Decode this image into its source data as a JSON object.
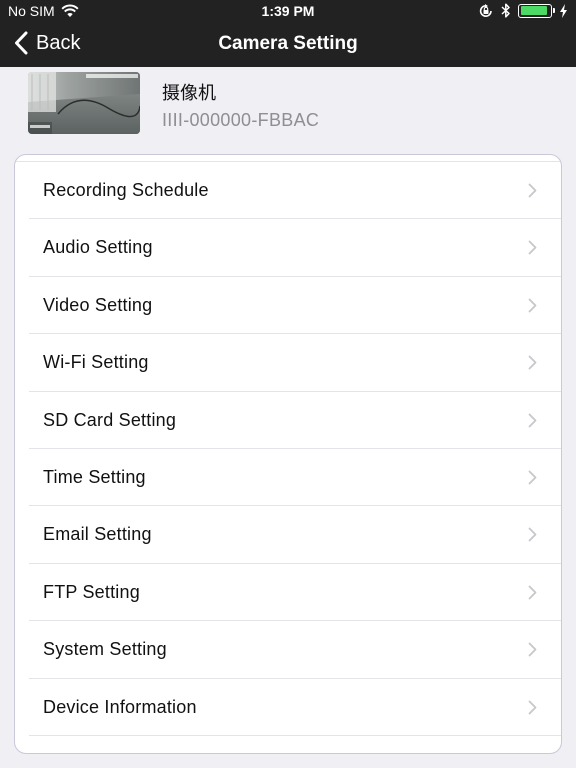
{
  "status_bar": {
    "carrier": "No SIM",
    "time": "1:39 PM",
    "battery_color": "#4cd964",
    "battery_level": 0.9,
    "icons": [
      "wifi-icon",
      "orientation-lock-icon",
      "bluetooth-icon",
      "battery-icon",
      "charging-bolt-icon"
    ]
  },
  "nav": {
    "back_label": "Back",
    "title": "Camera Setting",
    "back_icon": "chevron-left-icon"
  },
  "camera": {
    "name": "摄像机",
    "device_id": "IIII-000000-FBBAC",
    "thumbnail_icon": "camera-preview-thumbnail"
  },
  "settings": {
    "items": [
      {
        "label": "Recording Schedule"
      },
      {
        "label": "Audio Setting"
      },
      {
        "label": "Video Setting"
      },
      {
        "label": "Wi-Fi Setting"
      },
      {
        "label": "SD Card Setting"
      },
      {
        "label": "Time Setting"
      },
      {
        "label": "Email Setting"
      },
      {
        "label": "FTP Setting"
      },
      {
        "label": "System Setting"
      },
      {
        "label": "Device Information"
      }
    ],
    "chevron_icon": "chevron-right-icon"
  }
}
